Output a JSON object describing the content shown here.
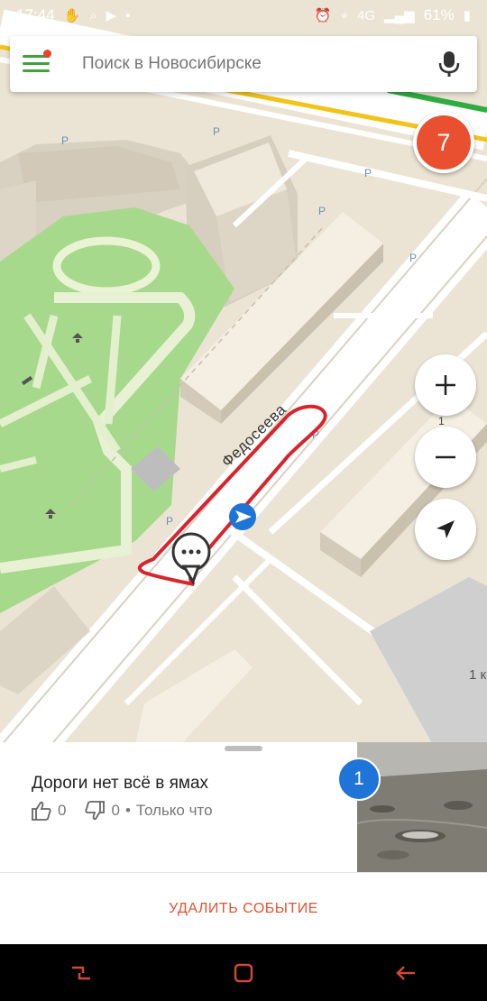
{
  "status_bar": {
    "time": "17:44",
    "battery": "61%",
    "network": "4G"
  },
  "search": {
    "placeholder": "Поиск в Новосибирске"
  },
  "notifications": {
    "count": "7"
  },
  "map": {
    "street_name": "Федосеева",
    "zoom_level": "1",
    "scale": "1 к",
    "parking_label": "P"
  },
  "event_card": {
    "title": "Дороги нет всё в ямах",
    "likes": "0",
    "dislikes": "0",
    "separator": "•",
    "time": "Только что",
    "photo_count": "1"
  },
  "actions": {
    "delete_label": "УДАЛИТЬ СОБЫТИЕ"
  },
  "colors": {
    "accent_red": "#e8502f",
    "menu_green": "#3fa23a",
    "badge_blue": "#1f74d8"
  }
}
